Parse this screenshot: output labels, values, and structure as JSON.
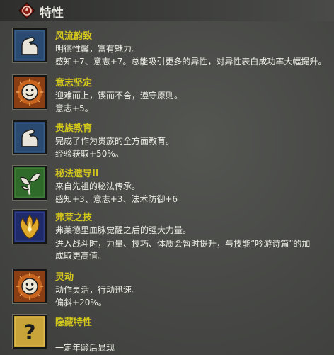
{
  "header": {
    "title": "特性",
    "icon": "red-diamond-badge-icon"
  },
  "traits": [
    {
      "name": "风流韵致",
      "icon": "flexed-arm-icon",
      "lines": [
        "明德惟馨，富有魅力。",
        "感知+7、意志+7。总能吸引更多的异性，对异性表白成功率大幅提升。"
      ]
    },
    {
      "name": "意志坚定",
      "icon": "smiley-face-icon",
      "lines": [
        "迎难而上，锲而不舍，遵守原则。",
        "意志+5。"
      ]
    },
    {
      "name": "贵族教育",
      "icon": "flexed-arm-icon",
      "lines": [
        "完成了作为贵族的全方面教育。",
        "经验获取+50%。"
      ]
    },
    {
      "name": "秘法遗导II",
      "icon": "sprout-icon",
      "lines": [
        "来自先祖的秘法传承。",
        "感知+3、意志+3、法术防御+6"
      ]
    },
    {
      "name": "弗莱之技",
      "icon": "golden-flame-crest-icon",
      "lines": [
        "弗莱德里血脉觉醒之后的强大力量。",
        "进入战斗时，力量、技巧、体质会暂时提升，与技能“吟游诗篇”的加",
        "成取更高值。"
      ]
    },
    {
      "name": "灵动",
      "icon": "smiley-face-icon",
      "lines": [
        "动作灵活，行动迅速。",
        "偏斜+20%。"
      ]
    },
    {
      "name": "隐藏特性",
      "icon": "question-mark-icon",
      "lines": [
        "",
        "一定年龄后显现"
      ]
    }
  ]
}
